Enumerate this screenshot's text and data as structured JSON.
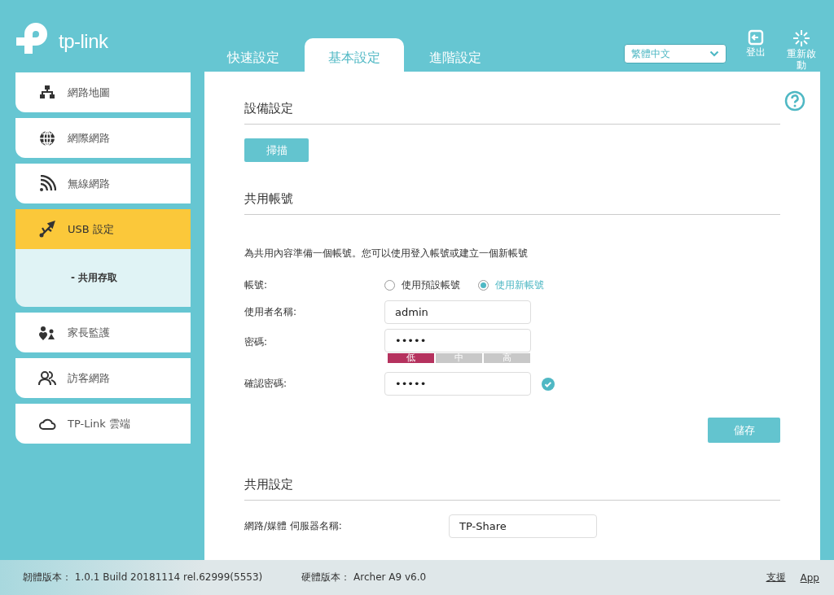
{
  "logo": {
    "text": "tp-link"
  },
  "tabs": [
    {
      "label": "快速設定",
      "selected": false
    },
    {
      "label": "基本設定",
      "selected": true
    },
    {
      "label": "進階設定",
      "selected": false
    }
  ],
  "language": {
    "value": "繁體中文"
  },
  "header_actions": [
    {
      "label": "登出"
    },
    {
      "label": "重新啟動"
    }
  ],
  "sidebar": {
    "items": [
      {
        "label": "網路地圖",
        "selected": false
      },
      {
        "label": "網際網路",
        "selected": false
      },
      {
        "label": "無線網路",
        "selected": false
      },
      {
        "label": "USB 設定",
        "selected": true,
        "children": [
          {
            "label": "- 共用存取",
            "selected": true
          }
        ]
      },
      {
        "label": "家長監護",
        "selected": false
      },
      {
        "label": "訪客網路",
        "selected": false
      },
      {
        "label": "TP-Link 雲端",
        "selected": false
      }
    ]
  },
  "sections": [
    {
      "title": "設備設定",
      "scan_button": "掃描"
    },
    {
      "title": "共用帳號",
      "description": "為共用內容準備一個帳號。您可以使用登入帳號或建立一個新帳號",
      "account": {
        "label": "帳號:",
        "options": [
          {
            "label": "使用預設帳號",
            "selected": false
          },
          {
            "label": "使用新帳號",
            "selected": true
          }
        ]
      },
      "username": {
        "label": "使用者名稱:",
        "value": "admin"
      },
      "password": {
        "label": "密碼:",
        "value": "•••••",
        "strength": [
          {
            "label": "低",
            "on": true
          },
          {
            "label": "中",
            "on": false
          },
          {
            "label": "高",
            "on": false
          }
        ]
      },
      "confirm": {
        "label": "確認密碼:",
        "value": "•••••",
        "matched": true
      },
      "save_button": "儲存"
    },
    {
      "title": "共用設定",
      "server_name": {
        "label": "網路/媒體 伺服器名稱:",
        "value": "TP-Share"
      }
    }
  ],
  "footer": {
    "firmware": "韌體版本： 1.0.1 Build 20181114 rel.62999(5553)",
    "hardware": "硬體版本： Archer A9 v6.0",
    "links": [
      "支援",
      "App"
    ]
  }
}
